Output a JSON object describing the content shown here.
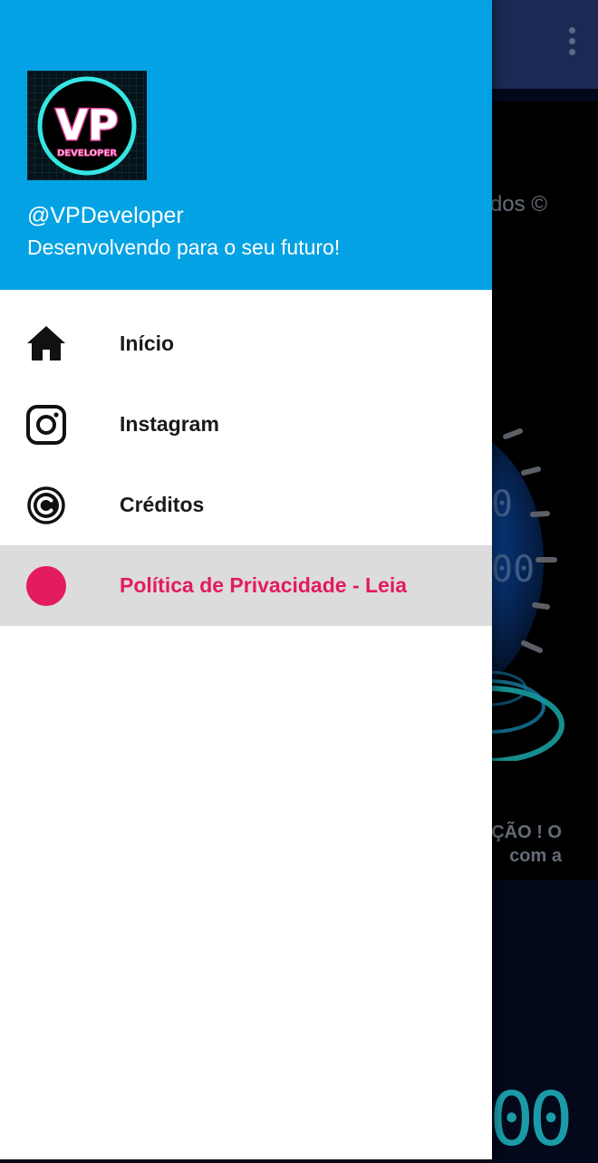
{
  "background": {
    "copyright_fragment": "dos ©",
    "notice_line1": "ÇÃO ! O",
    "notice_line2": "com a",
    "digits_fragment": "00"
  },
  "drawer": {
    "header": {
      "logo_text": "VP",
      "logo_subtext": "DEVELOPER",
      "username": "@VPDeveloper",
      "tagline": "Desenvolvendo para o seu futuro!"
    },
    "items": [
      {
        "label": "Início",
        "icon": "home-icon"
      },
      {
        "label": "Instagram",
        "icon": "instagram-icon"
      },
      {
        "label": "Créditos",
        "icon": "copyright-icon"
      },
      {
        "label": "Política de Privacidade - Leia",
        "icon": "circle-icon",
        "selected": true
      }
    ]
  },
  "colors": {
    "header": "#03a2e4",
    "accent": "#e31b5f",
    "selected_background": "#dcdcdc"
  }
}
